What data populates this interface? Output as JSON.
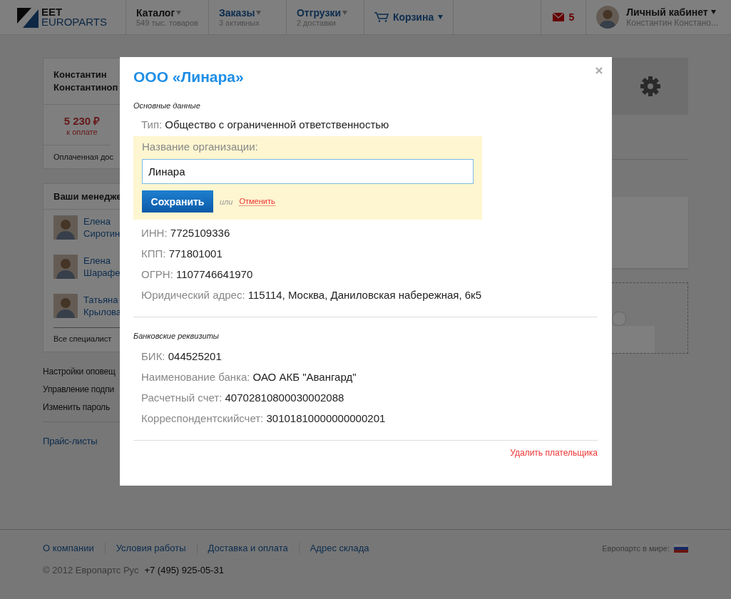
{
  "header": {
    "logo": {
      "line1": "EET",
      "line2": "EUROPARTS"
    },
    "nav": [
      {
        "label": "Каталог",
        "sub": "549 тыс. товаров",
        "kind": "plain"
      },
      {
        "label": "Заказы",
        "sub": "3 активных",
        "kind": "link"
      },
      {
        "label": "Отгрузки",
        "sub": "2 доставки",
        "kind": "link"
      }
    ],
    "cart": {
      "label": "Корзина"
    },
    "mail": {
      "count": "5"
    },
    "account": {
      "label": "Личный кабинет",
      "sub": "Константин Констано..."
    }
  },
  "sidebar": {
    "profile": {
      "name_lines": [
        "Константин",
        "Константиноп"
      ],
      "amount": "5 230 ₽",
      "amount_label": "к оплате",
      "note": "Оплаченная дос"
    },
    "managers": {
      "title": "Ваши менедже",
      "items": [
        {
          "first": "Елена",
          "last": "Сиротин"
        },
        {
          "first": "Елена",
          "last": "Шарафе"
        },
        {
          "first": "Татьяна",
          "last": "Крылова"
        }
      ],
      "all_link": "Все специалист"
    },
    "links": [
      "Настройки оповещ",
      "Управление подпи",
      "Изменить пароль"
    ],
    "price_lists": "Прайс-листы"
  },
  "modal": {
    "title": "ООО «Линара»",
    "sections": [
      {
        "title": "Основные данные",
        "items": [
          {
            "kind": "field",
            "label": "Тип:",
            "value": "Общество с ограниченной ответственностью"
          },
          {
            "kind": "editor",
            "label": "Название организации:",
            "value": "Линара",
            "save": "Сохранить",
            "or": "или",
            "cancel": "Отменить"
          },
          {
            "kind": "field",
            "label": "ИНН:",
            "value": "7725109336"
          },
          {
            "kind": "field",
            "label": "КПП:",
            "value": "771801001"
          },
          {
            "kind": "field",
            "label": "ОГРН:",
            "value": "1107746641970"
          },
          {
            "kind": "field",
            "label": "Юридический адрес:",
            "value": "115114, Москва, Даниловская набережная, 6к5"
          }
        ]
      },
      {
        "title": "Банковские реквизиты",
        "items": [
          {
            "kind": "field",
            "label": "БИК:",
            "value": "044525201"
          },
          {
            "kind": "field",
            "label": "Наименование банка:",
            "value": "ОАО АКБ \"Авангард\""
          },
          {
            "kind": "field",
            "label": "Расчетный счет:",
            "value": "40702810800030002088"
          },
          {
            "kind": "field",
            "label": "Корреспондентскийсчет:",
            "value": "30101810000000000201"
          }
        ]
      }
    ],
    "delete_link": "Удалить плательщика"
  },
  "footer": {
    "links": [
      "О компании",
      "Условия работы",
      "Доставка и оплата",
      "Адрес склада"
    ],
    "copyright": "© 2012 Европартс Рус",
    "phone": "+7 (495) 925-05-31",
    "world_label": "Европартс в мире:"
  }
}
